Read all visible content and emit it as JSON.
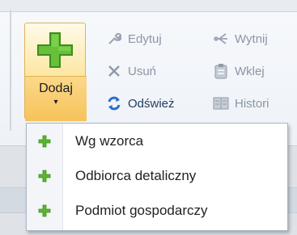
{
  "ribbon": {
    "add_button": {
      "label": "Dodaj",
      "icon": "green-plus-icon",
      "dropdown": "chevron-down-icon"
    },
    "small_buttons": [
      {
        "label": "Edytuj",
        "icon": "wrench-icon",
        "enabled": false
      },
      {
        "label": "Usuń",
        "icon": "close-x-icon",
        "enabled": false
      },
      {
        "label": "Odśwież",
        "icon": "refresh-icon",
        "enabled": true
      },
      {
        "label": "Wytnij",
        "icon": "scissors-icon",
        "enabled": false
      },
      {
        "label": "Wklej",
        "icon": "clipboard-icon",
        "enabled": false
      },
      {
        "label": "Histori",
        "icon": "history-book-icon",
        "enabled": false
      }
    ]
  },
  "dropdown_menu": {
    "items": [
      {
        "label": "Wg wzorca",
        "icon": "green-plus-icon"
      },
      {
        "label": "Odbiorca detaliczny",
        "icon": "green-plus-icon"
      },
      {
        "label": "Podmiot gospodarczy",
        "icon": "green-plus-icon"
      }
    ]
  },
  "colors": {
    "accent_plus": "#5cb531",
    "button_highlight": "#fbd77d",
    "refresh_blue": "#2a6fc9",
    "disabled_text": "#8a96a6"
  }
}
